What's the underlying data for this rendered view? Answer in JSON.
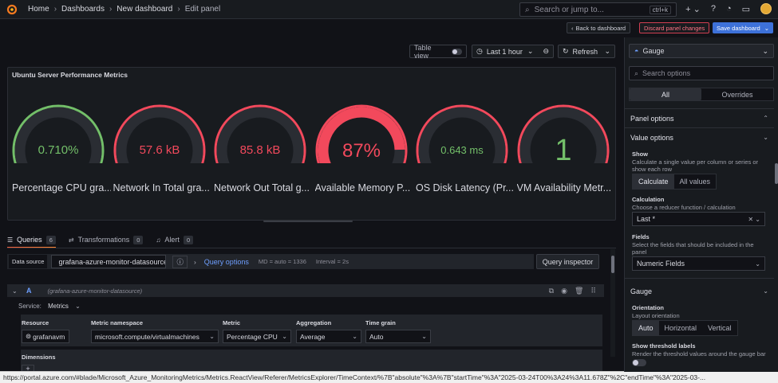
{
  "breadcrumb": {
    "home": "Home",
    "dashboards": "Dashboards",
    "new_dashboard": "New dashboard",
    "current": "Edit panel"
  },
  "search": {
    "placeholder": "Search or jump to...",
    "shortcut": "ctrl+k"
  },
  "actions": {
    "back": "Back to dashboard",
    "discard": "Discard panel changes",
    "save": "Save dashboard"
  },
  "toolbar": {
    "table_view": "Table view",
    "time_range": "Last 1 hour",
    "refresh": "Refresh"
  },
  "panel": {
    "title": "Ubuntu Server Performance Metrics",
    "gauges": [
      {
        "value": "0.710%",
        "label": "Percentage CPU gra...",
        "color": "#73bf69",
        "fill": 0.007,
        "value_color": "#73bf69"
      },
      {
        "value": "57.6 kB",
        "label": "Network In Total gra...",
        "color": "#f2495c",
        "fill": 0.0,
        "value_color": "#f2495c"
      },
      {
        "value": "85.8 kB",
        "label": "Network Out Total g...",
        "color": "#f2495c",
        "fill": 0.0,
        "value_color": "#f2495c"
      },
      {
        "value": "87%",
        "label": "Available Memory P...",
        "color": "#f2495c",
        "fill": 0.87,
        "value_color": "#f2495c"
      },
      {
        "value": "0.643 ms",
        "label": "OS Disk Latency (Pr...",
        "color": "#f2495c",
        "fill": 0.006,
        "value_color": "#73bf69"
      },
      {
        "value": "1",
        "label": "VM Availability Metr...",
        "color": "#f2495c",
        "fill": 0.01,
        "value_color": "#73bf69"
      }
    ]
  },
  "query_tabs": [
    {
      "label": "Queries",
      "count": "6"
    },
    {
      "label": "Transformations",
      "count": "0"
    },
    {
      "label": "Alert",
      "count": "0"
    }
  ],
  "datasource": {
    "label": "Data source",
    "value": "grafana-azure-monitor-datasource",
    "query_options": "Query options",
    "md": "MD = auto = 1336",
    "interval": "Interval = 2s",
    "inspector": "Query inspector"
  },
  "query": {
    "letter": "A",
    "datasource": "(grafana-azure-monitor-datasource)",
    "service_label": "Service:",
    "service_value": "Metrics",
    "resource_label": "Resource",
    "resource_value": "grafanavm",
    "namespace_label": "Metric namespace",
    "namespace_value": "microsoft.compute/virtualmachines",
    "metric_label": "Metric",
    "metric_value": "Percentage CPU",
    "aggregation_label": "Aggregation",
    "aggregation_value": "Average",
    "timegrain_label": "Time grain",
    "timegrain_value": "Auto",
    "dimensions_label": "Dimensions"
  },
  "status_url": "https://portal.azure.com/#blade/Microsoft_Azure_MonitoringMetrics/Metrics.ReactView/Referer/MetricsExplorer/TimeContext/%7B\"absolute\"%3A%7B\"startTime\"%3A\"2025-03-24T00%3A24%3A11.678Z\"%2C\"endTime\"%3A\"2025-03-...",
  "options": {
    "viz": "Gauge",
    "search_placeholder": "Search options",
    "tab_all": "All",
    "tab_overrides": "Overrides",
    "panel_options": "Panel options",
    "value_options": "Value options",
    "show_label": "Show",
    "show_desc": "Calculate a single value per column or series or show each row",
    "show_calculate": "Calculate",
    "show_all_values": "All values",
    "calc_label": "Calculation",
    "calc_desc": "Choose a reducer function / calculation",
    "calc_value": "Last *",
    "fields_label": "Fields",
    "fields_desc": "Select the fields that should be included in the panel",
    "fields_value": "Numeric Fields",
    "gauge_section": "Gauge",
    "orientation_label": "Orientation",
    "orientation_desc": "Layout orientation",
    "orient_auto": "Auto",
    "orient_horizontal": "Horizontal",
    "orient_vertical": "Vertical",
    "threshold_label": "Show threshold labels",
    "threshold_desc": "Render the threshold values around the gauge bar"
  }
}
